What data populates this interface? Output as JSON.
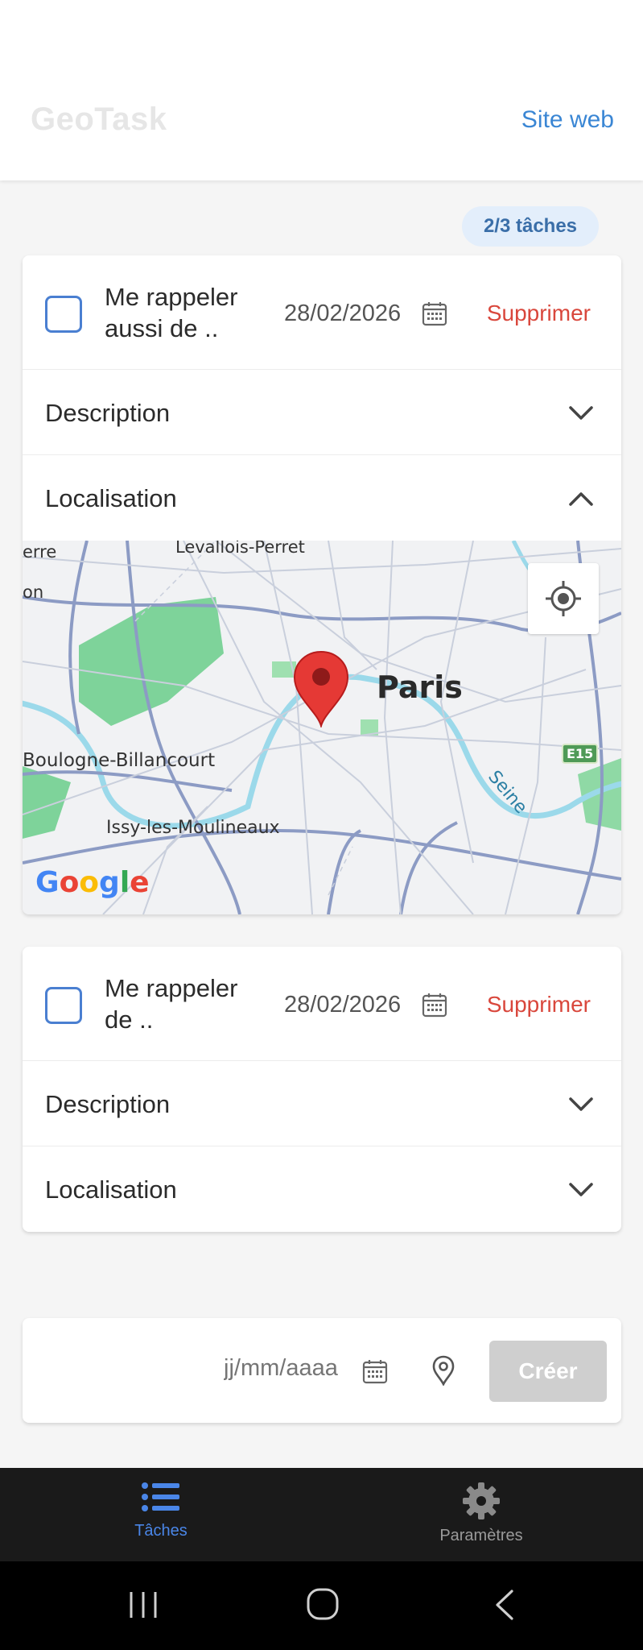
{
  "header": {
    "title": "GeoTask",
    "site_link": "Site web"
  },
  "counter": "2/3 tâches",
  "tasks": [
    {
      "title": "Me rappeler aussi de ..",
      "date": "28/02/2026",
      "delete_label": "Supprimer",
      "description_label": "Description",
      "location_label": "Localisation",
      "map": {
        "labels": [
          "Levallois-Perret",
          "erre",
          "on",
          "Paris",
          "Boulogne-Billancourt",
          "Issy-les-Moulineaux",
          "Seine",
          "E15"
        ],
        "brand": "Google"
      }
    },
    {
      "title": "Me rappeler de ..",
      "date": "28/02/2026",
      "delete_label": "Supprimer",
      "description_label": "Description",
      "location_label": "Localisation"
    }
  ],
  "composer": {
    "date_placeholder": "jj/mm/aaaa",
    "create_label": "Créer"
  },
  "nav": {
    "tasks_label": "Tâches",
    "settings_label": "Paramètres"
  },
  "colors": {
    "accent": "#3a86d4",
    "delete": "#d9473c",
    "nav_active": "#4a86e8"
  }
}
